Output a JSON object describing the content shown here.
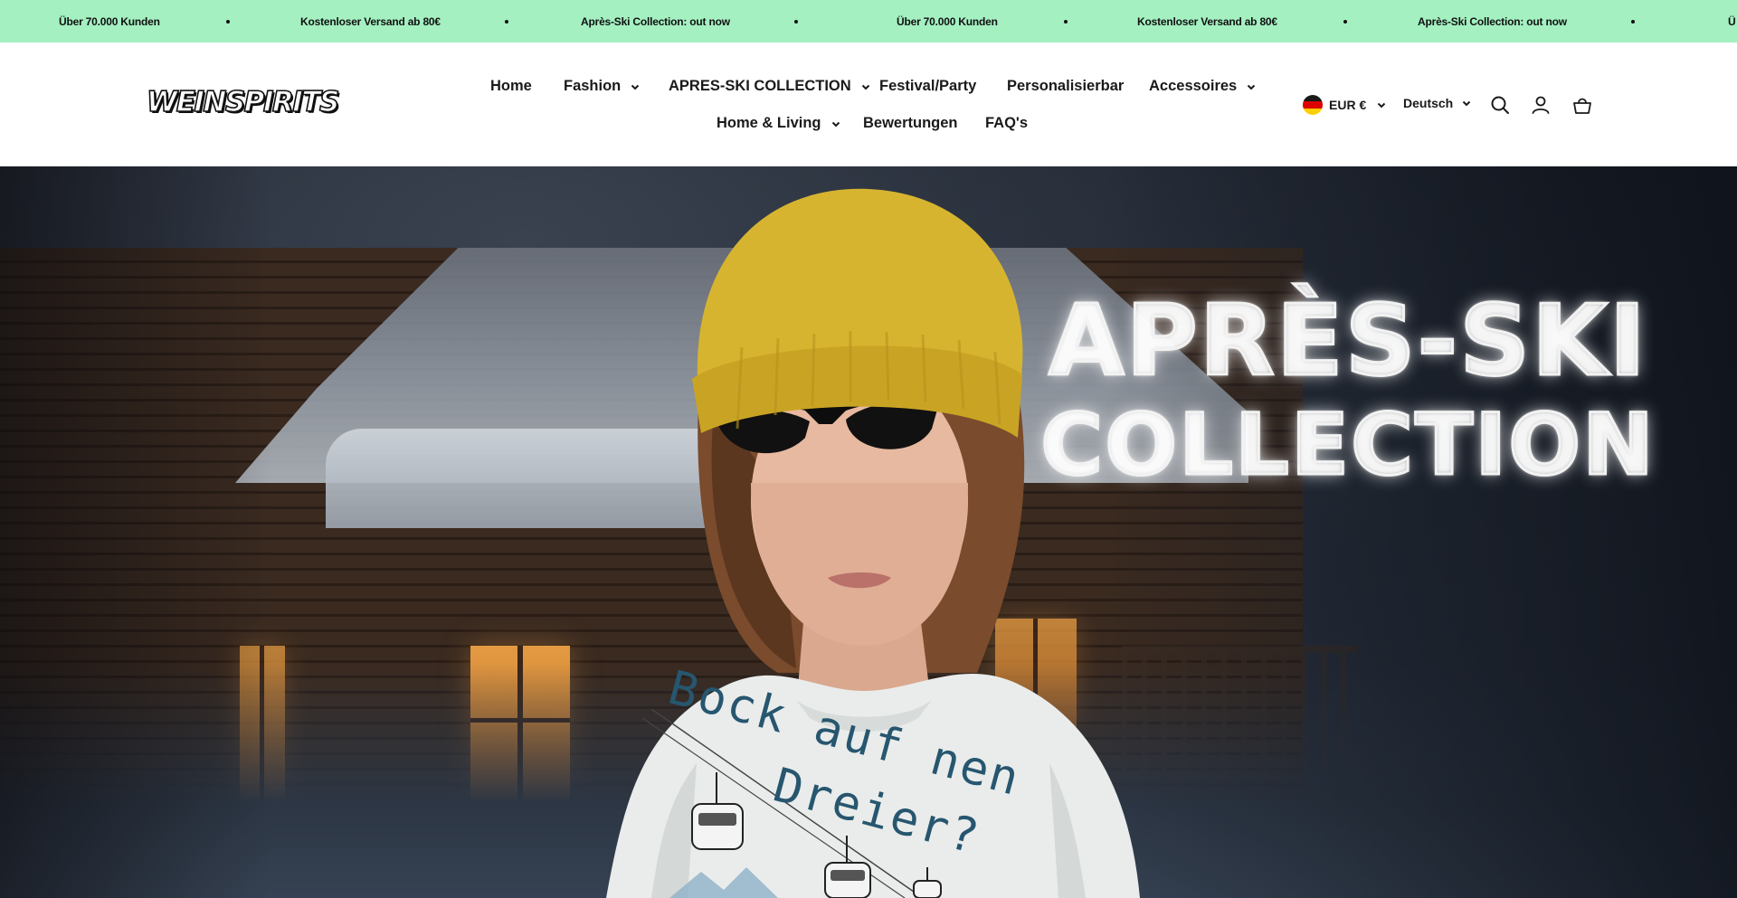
{
  "announcement": {
    "items": [
      "Über 70.000 Kunden",
      "Kostenloser Versand ab 80€",
      "Après-Ski Collection: out now",
      "Über 70.000 Kunden",
      "Kostenloser Versand ab 80€",
      "Après-Ski Collection: out now",
      "Ü"
    ],
    "background": "#a4f0c1"
  },
  "header": {
    "logo_text": "WEINSPIRITS",
    "nav": {
      "home": "Home",
      "fashion": "Fashion",
      "apres_ski": "APRES-SKI COLLECTION",
      "festival": "Festival/Party",
      "personalisierbar": "Personalisierbar",
      "accessoires": "Accessoires",
      "home_living": "Home & Living",
      "bewertungen": "Bewertungen",
      "faqs": "FAQ's"
    },
    "currency": "EUR €",
    "language": "Deutsch",
    "icons": [
      "search-icon",
      "account-icon",
      "cart-icon"
    ]
  },
  "hero": {
    "title_line1": "APRÈS-SKI",
    "title_line2": "COLLECTION",
    "sweater_text_line1": "Bock auf nen",
    "sweater_text_line2": "Dreier?"
  }
}
